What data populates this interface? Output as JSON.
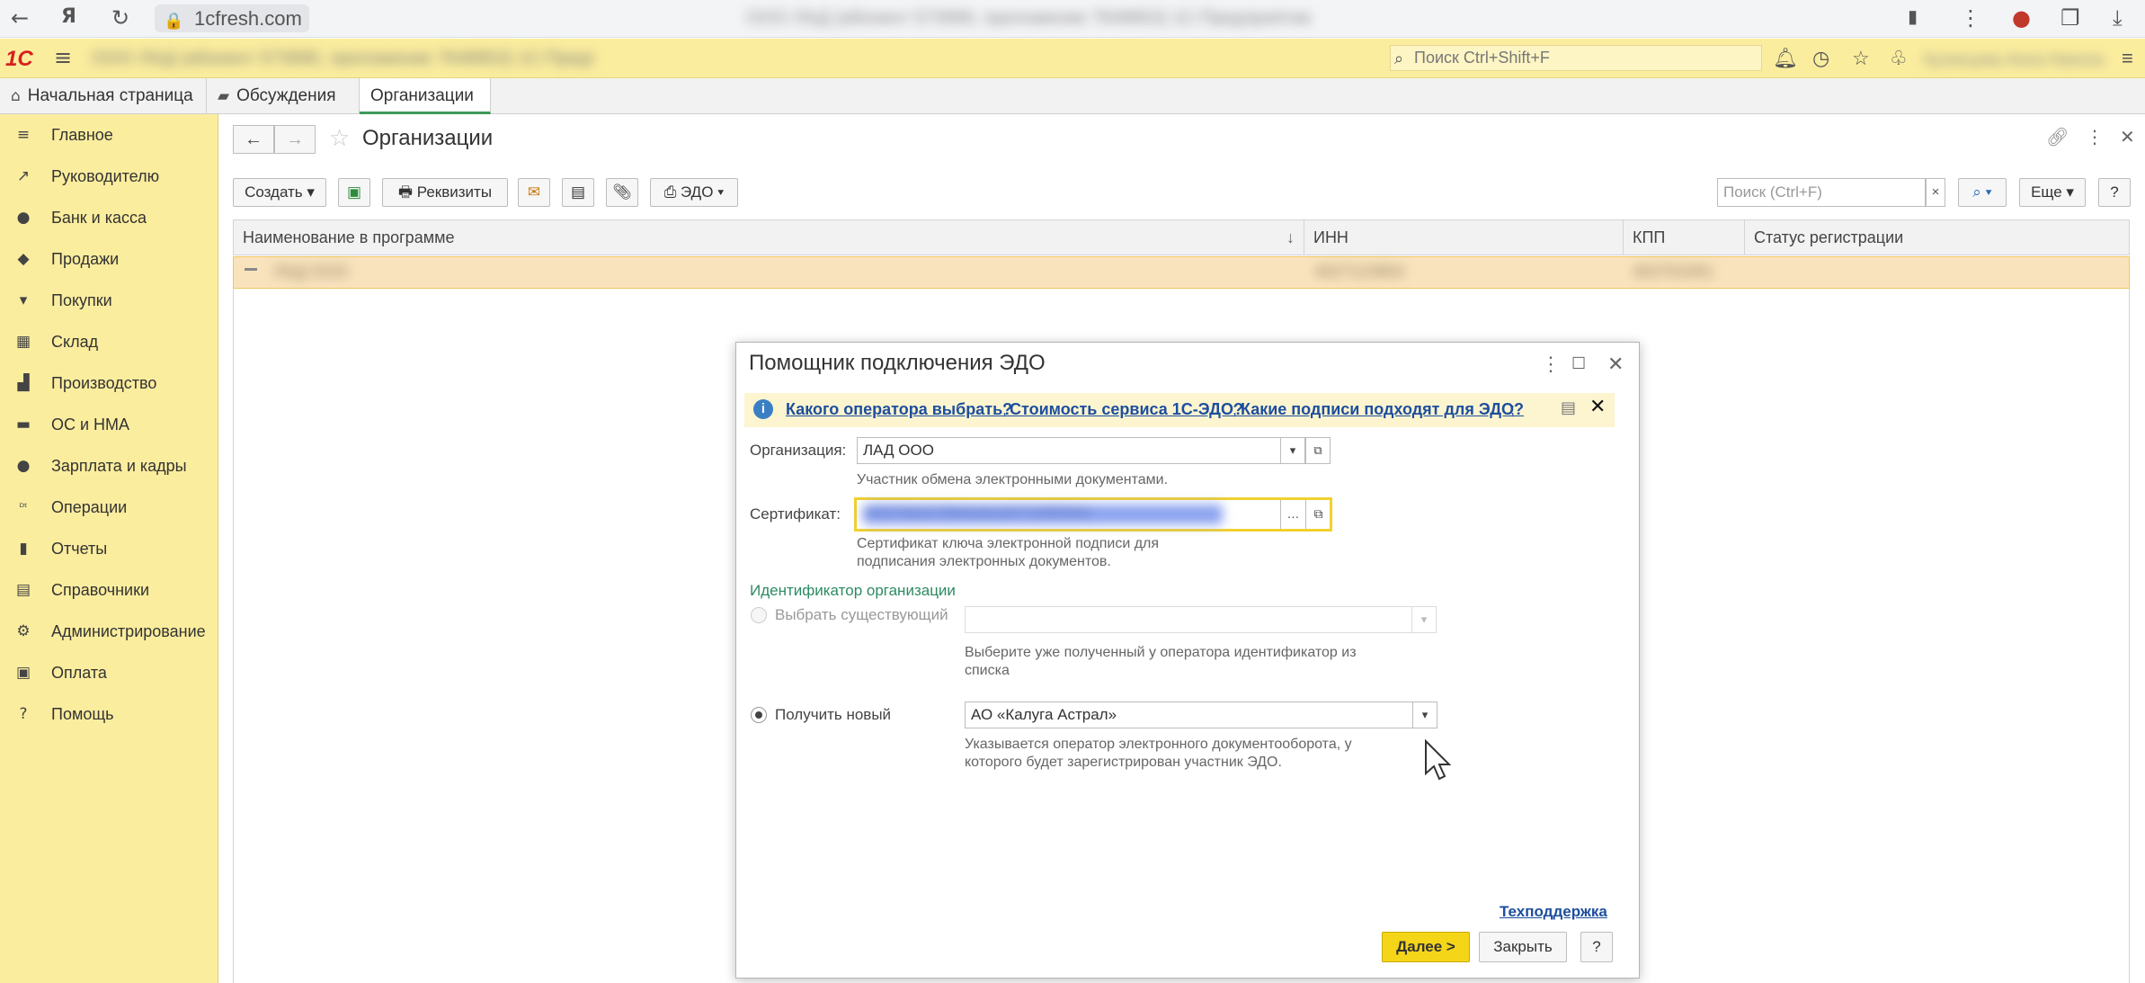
{
  "browser": {
    "url": "1cfresh.com",
    "window_title": "ООО ЛАД (абонент 573990, приложение 7648853) 1С:Предприятие"
  },
  "app": {
    "logo": "1С",
    "title": "ООО ЛАД (абонент 573990, приложение 7648853) 1С:Предприятие",
    "search_placeholder": "Поиск Ctrl+Shift+F",
    "user": "Кузнецова Анна Николаевна"
  },
  "tabs": [
    {
      "label": "Начальная страница",
      "icon": "home-icon"
    },
    {
      "label": "Обсуждения",
      "icon": "chat-icon"
    },
    {
      "label": "Организации",
      "icon": "",
      "close": "×"
    }
  ],
  "sidebar": {
    "items": [
      {
        "label": "Главное",
        "icon": "menu-icon"
      },
      {
        "label": "Руководителю",
        "icon": "trend-icon"
      },
      {
        "label": "Банк и касса",
        "icon": "coin-icon"
      },
      {
        "label": "Продажи",
        "icon": "bag-icon"
      },
      {
        "label": "Покупки",
        "icon": "cart-icon"
      },
      {
        "label": "Склад",
        "icon": "grid-icon"
      },
      {
        "label": "Производство",
        "icon": "factory-icon"
      },
      {
        "label": "ОС и НМА",
        "icon": "truck-icon"
      },
      {
        "label": "Зарплата и кадры",
        "icon": "person-icon"
      },
      {
        "label": "Операции",
        "icon": "dtkt-icon"
      },
      {
        "label": "Отчеты",
        "icon": "bar-chart-icon"
      },
      {
        "label": "Справочники",
        "icon": "book-icon"
      },
      {
        "label": "Администрирование",
        "icon": "gear-icon"
      },
      {
        "label": "Оплата",
        "icon": "wallet-icon"
      },
      {
        "label": "Помощь",
        "icon": "question-icon"
      }
    ]
  },
  "page": {
    "title": "Организации",
    "toolbar": {
      "create": "Создать ▾",
      "requisites": "Реквизиты",
      "edo": "ЭДО ▾",
      "search_placeholder": "Поиск (Ctrl+F)",
      "more": "Еще ▾",
      "help": "?"
    },
    "table": {
      "columns": [
        "Наименование в программе",
        "ИНН",
        "КПП",
        "Статус регистрации"
      ],
      "rows": [
        {
          "name": "ЛАД ООО",
          "inn": "4027123954",
          "kpp": "402701001",
          "status": ""
        }
      ]
    }
  },
  "dialog": {
    "title": "Помощник подключения ЭДО",
    "links": [
      "Какого оператора выбрать?",
      "Стоимость сервиса 1С-ЭДО?",
      "Какие подписи подходят для ЭДО?"
    ],
    "org_label": "Организация:",
    "org_value": "ЛАД ООО",
    "org_hint": "Участник обмена электронными документами.",
    "cert_label": "Сертификат:",
    "cert_value": "a3f1f7be2c7f9b4cde1af77c5f9f3b4c",
    "cert_hint": "Сертификат ключа электронной подписи для подписания электронных документов.",
    "id_group_title": "Идентификатор организации",
    "option_existing": "Выбрать существующий",
    "existing_hint": "Выберите уже полученный у оператора идентификатор из списка",
    "option_new": "Получить новый",
    "operator_value": "АО «Калуга Астрал»",
    "operator_hint": "Указывается оператор электронного документооборота, у которого будет зарегистрирован участник ЭДО.",
    "support_link": "Техподдержка",
    "next_button": "Далее >",
    "close_button": "Закрыть",
    "help_button": "?"
  }
}
